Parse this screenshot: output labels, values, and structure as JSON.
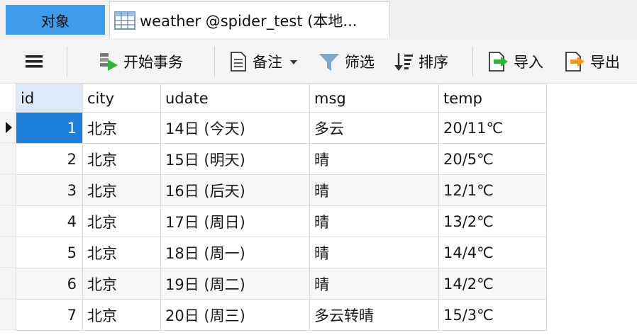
{
  "tabs": {
    "objects": "对象",
    "table": "weather @spider_test (本地..."
  },
  "toolbar": {
    "begin_tx": "开始事务",
    "note": "备注",
    "filter": "筛选",
    "sort": "排序",
    "import": "导入",
    "export": "导出"
  },
  "columns": [
    "id",
    "city",
    "udate",
    "msg",
    "temp"
  ],
  "rows": [
    {
      "id": "1",
      "city": "北京",
      "udate": "14日 (今天)",
      "msg": "多云",
      "temp": "20/11℃"
    },
    {
      "id": "2",
      "city": "北京",
      "udate": "15日 (明天)",
      "msg": "晴",
      "temp": "20/5℃"
    },
    {
      "id": "3",
      "city": "北京",
      "udate": "16日 (后天)",
      "msg": "晴",
      "temp": "12/1℃"
    },
    {
      "id": "4",
      "city": "北京",
      "udate": "17日 (周日)",
      "msg": "晴",
      "temp": "13/2℃"
    },
    {
      "id": "5",
      "city": "北京",
      "udate": "18日 (周一)",
      "msg": "晴",
      "temp": "14/4℃"
    },
    {
      "id": "6",
      "city": "北京",
      "udate": "19日 (周二)",
      "msg": "晴",
      "temp": "14/2℃"
    },
    {
      "id": "7",
      "city": "北京",
      "udate": "20日 (周三)",
      "msg": "多云转晴",
      "temp": "15/3℃"
    }
  ],
  "colors": {
    "accent": "#3d9be9",
    "selected": "#1e7fd8"
  }
}
